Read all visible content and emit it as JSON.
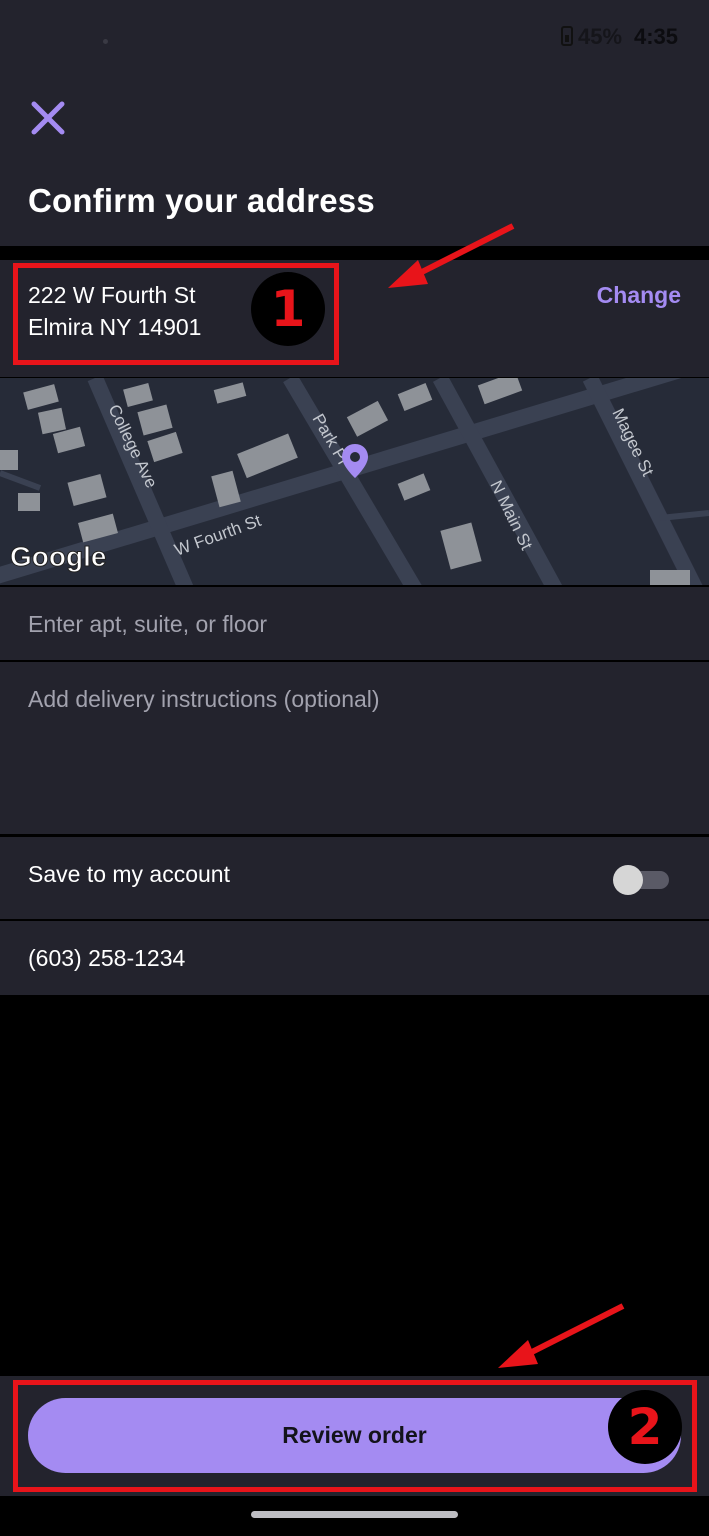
{
  "status_bar": {
    "battery_percent": "45%",
    "time": "4:35"
  },
  "header": {
    "title": "Confirm your address",
    "close_icon": "close-icon"
  },
  "address": {
    "line1": "222 W Fourth St",
    "line2": "Elmira NY 14901",
    "change_label": "Change"
  },
  "map": {
    "attribution": "Google",
    "street_labels": [
      "College Ave",
      "Park Pl",
      "W Fourth St",
      "N Main St",
      "Magee St"
    ],
    "pin_color": "#a48bf2"
  },
  "form": {
    "apt_placeholder": "Enter apt, suite, or floor",
    "instructions_placeholder": "Add delivery instructions (optional)",
    "save_label": "Save to my account",
    "save_toggle_on": false,
    "phone": "(603) 258-1234"
  },
  "footer": {
    "review_label": "Review order"
  },
  "annotations": {
    "badge1": "1",
    "badge2": "2"
  },
  "colors": {
    "accent": "#a48bf2",
    "background": "#23232d",
    "annotation": "#e8141a"
  }
}
